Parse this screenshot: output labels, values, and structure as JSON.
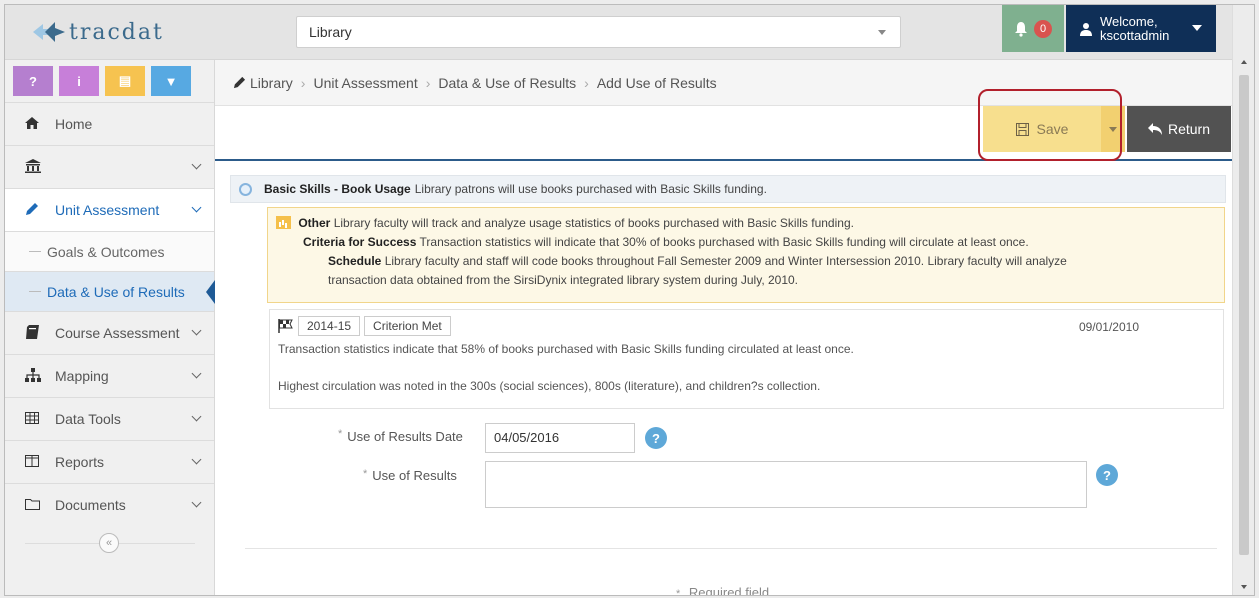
{
  "app": {
    "brand": "tracdat"
  },
  "header": {
    "unit_selector": "Library",
    "notifications": {
      "count": "0",
      "icon": "bell-icon"
    },
    "user": {
      "welcome": "Welcome,",
      "name": "kscottadmin"
    }
  },
  "quick_buttons": [
    {
      "label": "?",
      "color": "#b57fcf"
    },
    {
      "label": "i",
      "color": "#c77fd9"
    },
    {
      "label": "▤",
      "color": "#f6c350"
    },
    {
      "label": "▼",
      "color": "#57a9e2"
    }
  ],
  "sidebar": {
    "items": [
      {
        "label": "Home",
        "icon": "home-icon"
      },
      {
        "label": "",
        "icon": "institution-icon"
      },
      {
        "label": "Unit Assessment",
        "icon": "pencil-icon"
      },
      {
        "label": "Course Assessment",
        "icon": "book-icon"
      },
      {
        "label": "Mapping",
        "icon": "sitemap-icon"
      },
      {
        "label": "Data Tools",
        "icon": "table-icon"
      },
      {
        "label": "Reports",
        "icon": "columns-icon"
      },
      {
        "label": "Documents",
        "icon": "folder-icon"
      }
    ],
    "sub_items": [
      "Goals & Outcomes",
      "Data & Use of Results"
    ],
    "collapse": "«"
  },
  "breadcrumb": [
    "Library",
    "Unit Assessment",
    "Data & Use of Results",
    "Add Use of Results"
  ],
  "toolbar": {
    "save_label": "Save",
    "return_label": "Return",
    "save_color": "#f7df8e",
    "return_color": "#525252"
  },
  "goal": {
    "title": "Basic Skills - Book Usage",
    "text": "Library patrons will use books purchased with Basic Skills funding."
  },
  "measure": {
    "type": "Other",
    "text": "Library faculty will track and analyze usage statistics of books purchased with Basic Skills funding.",
    "criteria_label": "Criteria for Success",
    "criteria_text": "Transaction statistics will indicate that 30% of books purchased with Basic Skills funding will circulate at least once.",
    "schedule_label": "Schedule",
    "schedule_text": "Library faculty and staff will code books throughout Fall Semester 2009 and Winter Intersession 2010.  Library faculty will analyze",
    "schedule_text_2": "transaction data obtained from the SirsiDynix integrated library system during July, 2010."
  },
  "result": {
    "year": "2014-15",
    "status": "Criterion Met",
    "date": "09/01/2010",
    "line1": "Transaction statistics indicate that 58% of books purchased with Basic Skills funding circulated at least once.",
    "line2": "Highest circulation was noted in the 300s (social sciences), 800s (literature), and children?s collection."
  },
  "form": {
    "date_label": "Use of Results Date",
    "date_value": "04/05/2016",
    "results_label": "Use of Results",
    "results_value": "",
    "required_marker": "*",
    "required_note": "Required field",
    "help": "?"
  }
}
